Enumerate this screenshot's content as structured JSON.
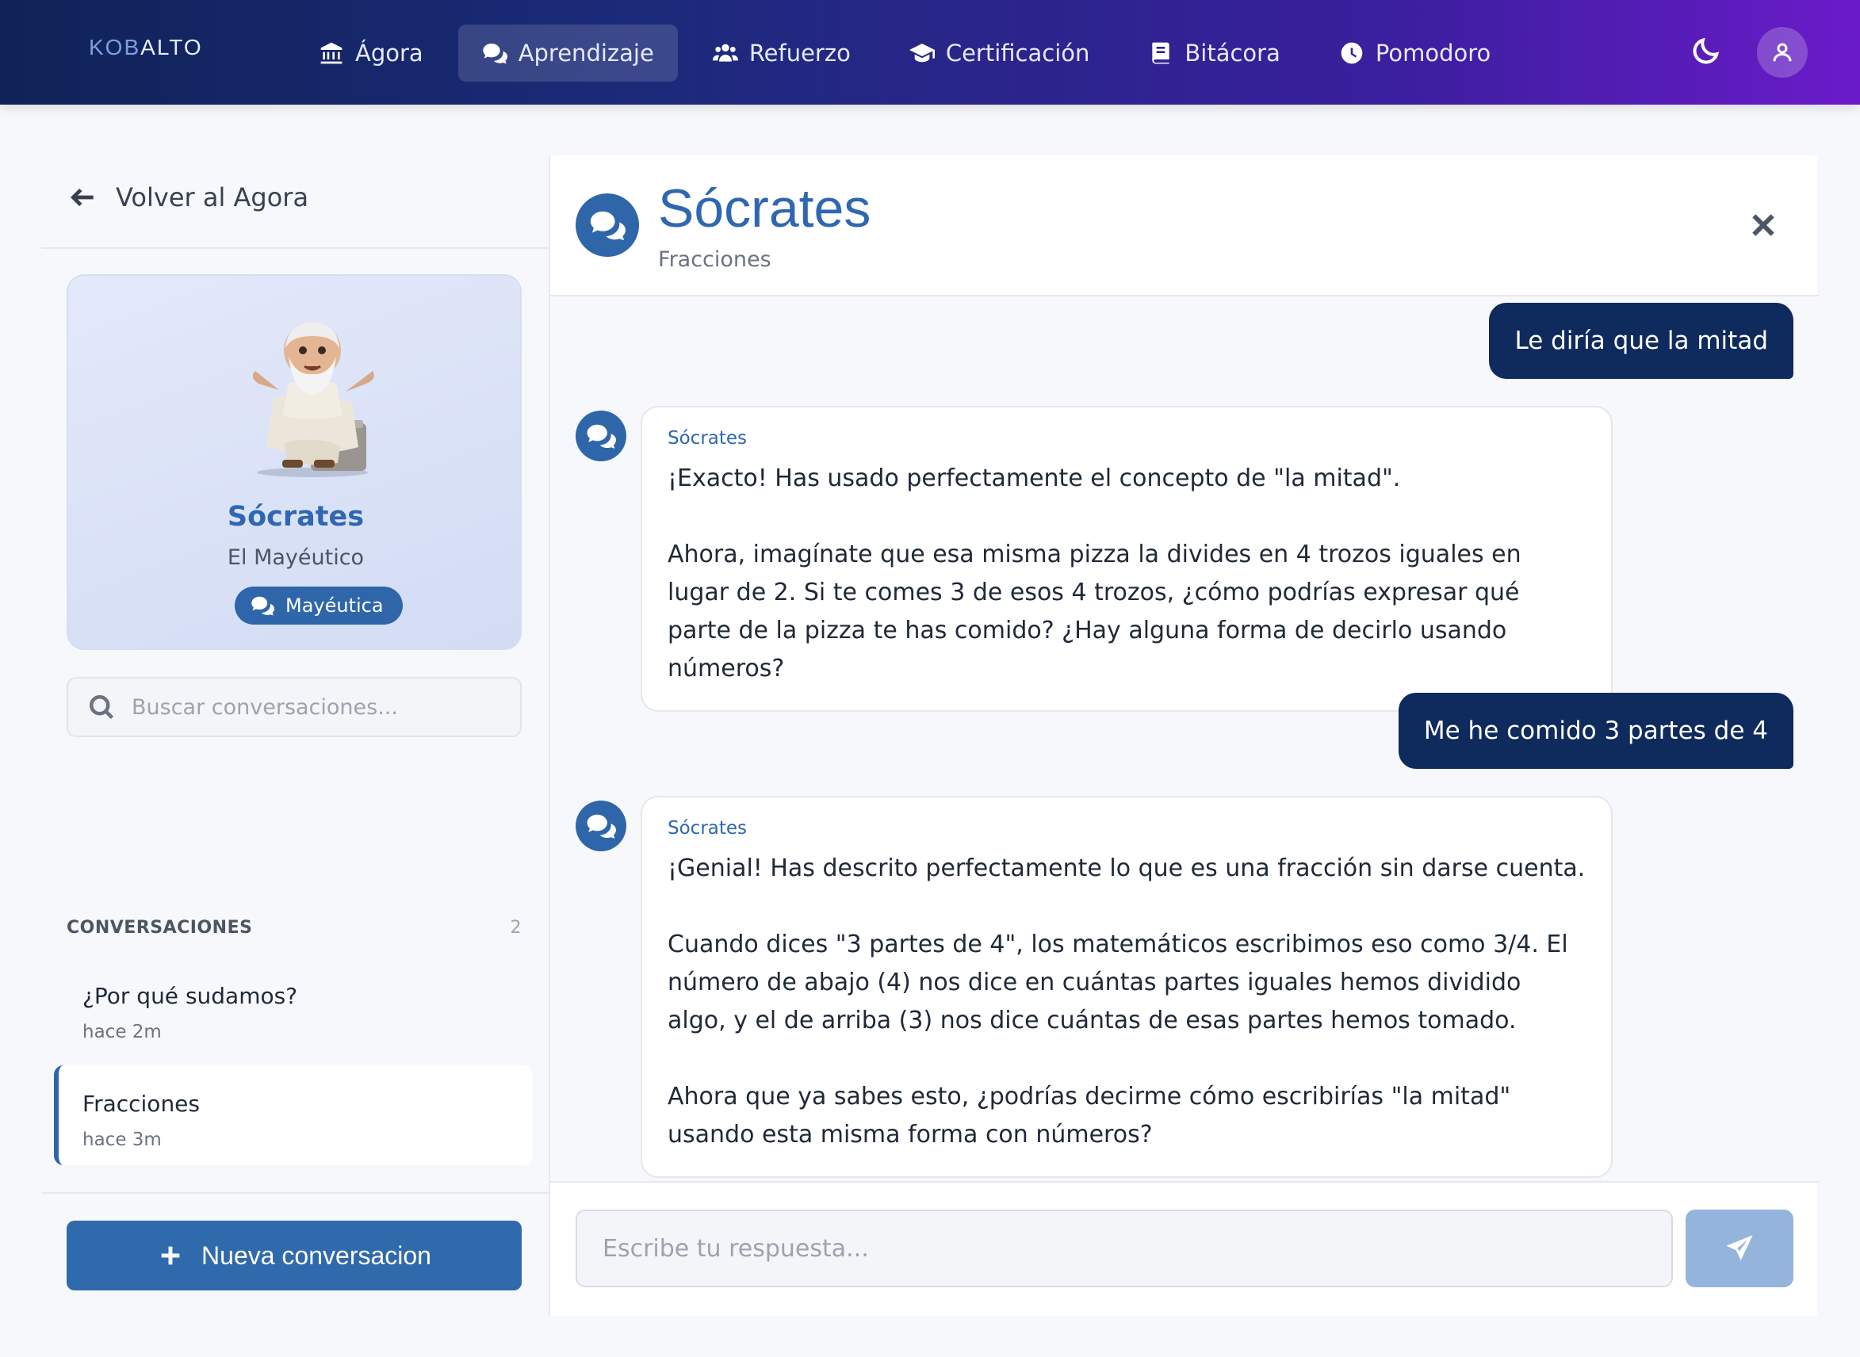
{
  "brand": {
    "prefix": "KOB",
    "rest": "ALTO"
  },
  "nav": {
    "items": [
      {
        "label": "Ágora",
        "icon": "landmark-icon"
      },
      {
        "label": "Aprendizaje",
        "icon": "chat-bubbles-icon",
        "active": true
      },
      {
        "label": "Refuerzo",
        "icon": "users-icon"
      },
      {
        "label": "Certificación",
        "icon": "graduation-cap-icon"
      },
      {
        "label": "Bitácora",
        "icon": "book-icon"
      },
      {
        "label": "Pomodoro",
        "icon": "clock-icon"
      }
    ]
  },
  "sidebar": {
    "back_label": "Volver al Agora",
    "tutor": {
      "name": "Sócrates",
      "subtitle": "El Mayéutico",
      "badge": "Mayéutica"
    },
    "search_placeholder": "Buscar conversaciones...",
    "conversations_header": "CONVERSACIONES",
    "conversations_count": "2",
    "conversations": [
      {
        "title": "¿Por qué sudamos?",
        "time": "hace 2m"
      },
      {
        "title": "Fracciones",
        "time": "hace 3m",
        "active": true
      }
    ],
    "new_conversation_label": "Nueva conversacion"
  },
  "chat": {
    "title": "Sócrates",
    "subtitle": "Fracciones",
    "messages": [
      {
        "role": "user",
        "text": "Le diría que la mitad"
      },
      {
        "role": "bot",
        "name": "Sócrates",
        "paragraphs": [
          "¡Exacto! Has usado perfectamente el concepto de \"la mitad\".",
          "Ahora, imagínate que esa misma pizza la divides en 4 trozos iguales en lugar de 2. Si te comes 3 de esos 4 trozos, ¿cómo podrías expresar qué parte de la pizza te has comido? ¿Hay alguna forma de decirlo usando números?"
        ]
      },
      {
        "role": "user",
        "text": "Me he comido 3 partes de 4"
      },
      {
        "role": "bot",
        "name": "Sócrates",
        "paragraphs": [
          "¡Genial! Has descrito perfectamente lo que es una fracción sin darse cuenta.",
          "Cuando dices \"3 partes de 4\", los matemáticos escribimos eso como 3/4. El número de abajo (4) nos dice en cuántas partes iguales hemos dividido algo, y el de arriba (3) nos dice cuántas de esas partes hemos tomado.",
          "Ahora que ya sabes esto, ¿podrías decirme cómo escribirías \"la mitad\" usando esta misma forma con números?"
        ]
      }
    ],
    "input_placeholder": "Escribe tu respuesta..."
  },
  "colors": {
    "primary": "#2f66aa",
    "user_bubble": "#0f2a5c",
    "title_blue": "#2f67b0",
    "send_disabled": "#94b4db"
  }
}
